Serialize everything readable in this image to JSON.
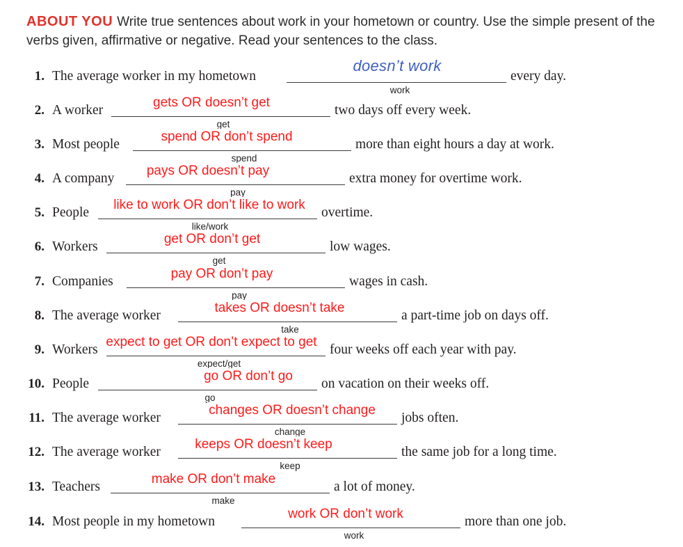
{
  "header": {
    "tag": "ABOUT YOU",
    "instructions": "Write true sentences about work in your hometown or country. Use the simple present of the verbs given, affirmative or negative. Read your sentences to the class."
  },
  "items": [
    {
      "num": "1.",
      "pre": "The average worker in my hometown",
      "verb": "work",
      "answer": "doesn’t work",
      "post": "every day."
    },
    {
      "num": "2.",
      "pre": "A worker",
      "verb": "get",
      "answer": "gets OR doesn’t get",
      "post": "two days off every week."
    },
    {
      "num": "3.",
      "pre": "Most people",
      "verb": "spend",
      "answer": "spend OR don’t spend",
      "post": "more than eight hours a day at work."
    },
    {
      "num": "4.",
      "pre": "A company",
      "verb": "pay",
      "answer": "pays OR doesn’t pay",
      "post": "extra money for overtime work."
    },
    {
      "num": "5.",
      "pre": "People",
      "verb": "like/work",
      "answer": "like to work OR don’t like to work",
      "post": "overtime."
    },
    {
      "num": "6.",
      "pre": "Workers",
      "verb": "get",
      "answer": "get OR don’t get",
      "post": "low wages."
    },
    {
      "num": "7.",
      "pre": "Companies",
      "verb": "pay",
      "answer": "pay OR don’t pay",
      "post": "wages in cash."
    },
    {
      "num": "8.",
      "pre": "The average worker",
      "verb": "take",
      "answer": "takes OR doesn’t take",
      "post": "a part-time job on days off."
    },
    {
      "num": "9.",
      "pre": "Workers",
      "verb": "expect/get",
      "answer": "expect to get OR don’t expect to get",
      "post": "four weeks off each year with pay."
    },
    {
      "num": "10.",
      "pre": "People",
      "verb": "go",
      "answer": "go OR don’t go",
      "post": "on vacation on their weeks off."
    },
    {
      "num": "11.",
      "pre": "The average worker",
      "verb": "change",
      "answer": "changes OR doesn’t change",
      "post": "jobs often."
    },
    {
      "num": "12.",
      "pre": "The average worker",
      "verb": "keep",
      "answer": "keeps OR doesn’t keep",
      "post": "the same job for a long time."
    },
    {
      "num": "13.",
      "pre": "Teachers",
      "verb": "make",
      "answer": "make OR don’t make",
      "post": "a lot of money."
    },
    {
      "num": "14.",
      "pre": "Most people in my hometown",
      "verb": "work",
      "answer": "work OR don’t work",
      "post": "more than one job."
    }
  ]
}
